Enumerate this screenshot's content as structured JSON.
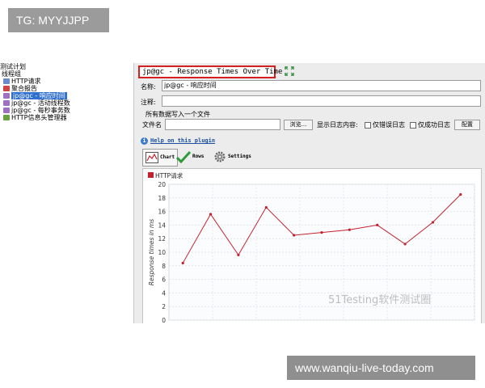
{
  "watermark_top": "TG: MYYJJPP",
  "watermark_bottom": "www.wanqiu-live-today.com",
  "tree": {
    "items": [
      {
        "label": "测试计划",
        "selected": false
      },
      {
        "label": "线程组",
        "selected": false
      },
      {
        "label": "HTTP请求",
        "selected": false
      },
      {
        "label": "聚合报告",
        "selected": false
      },
      {
        "label": "jp@gc - 响应时间",
        "selected": true
      },
      {
        "label": "jp@gc - 活动线程数",
        "selected": false
      },
      {
        "label": "jp@gc - 每秒事务数",
        "selected": false
      },
      {
        "label": "HTTP信息头管理器",
        "selected": false
      }
    ]
  },
  "panel": {
    "title": "jp@gc - Response Times Over Time",
    "name_label": "名称:",
    "name_value": "jp@gc - 响应时间",
    "comment_label": "注释:",
    "comment_value": "",
    "write_all_label": "所有数据写入一个文件",
    "filename_label": "文件名",
    "filename_value": "",
    "browse_label": "浏览...",
    "log_label": "显示日志内容:",
    "errors_only_label": "仅错误日志",
    "success_only_label": "仅成功日志",
    "configure_label": "配置",
    "help_link": "Help on this plugin",
    "tabs": [
      {
        "label": "Chart",
        "active": true
      },
      {
        "label": "Rows",
        "active": false
      },
      {
        "label": "Settings",
        "active": false
      }
    ]
  },
  "colors": {
    "series": "#c4202e",
    "title_border": "#d42020",
    "selection": "#2f6fcf"
  },
  "chart_data": {
    "type": "line",
    "series": [
      {
        "name": "HTTP请求",
        "values": [
          8.4,
          15.6,
          9.6,
          16.6,
          12.5,
          12.9,
          13.3,
          14.0,
          11.2,
          14.4,
          18.5
        ]
      }
    ],
    "x": [
      1,
      2,
      3,
      4,
      5,
      6,
      7,
      8,
      9,
      10,
      11
    ],
    "ylabel": "Response times in ms",
    "ylim": [
      0,
      20
    ],
    "yticks": [
      "20",
      "18",
      "16",
      "14",
      "12",
      "10",
      "8",
      "6",
      "4",
      "2",
      "0"
    ],
    "grid": true,
    "legend": "top-left"
  },
  "brand_text": "51Testing软件测试圈"
}
